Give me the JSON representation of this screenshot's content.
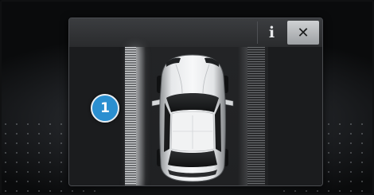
{
  "toolbar": {
    "info_label": "i",
    "close_label": "✕"
  },
  "marker": {
    "label": "1"
  },
  "colors": {
    "marker_fill": "#2b8fd0",
    "close_button": "#bfc1c3",
    "panel_background": "#1c1d1f"
  },
  "icons": {
    "info": "info-icon",
    "close": "close-icon",
    "car": "car-top-view-icon"
  }
}
